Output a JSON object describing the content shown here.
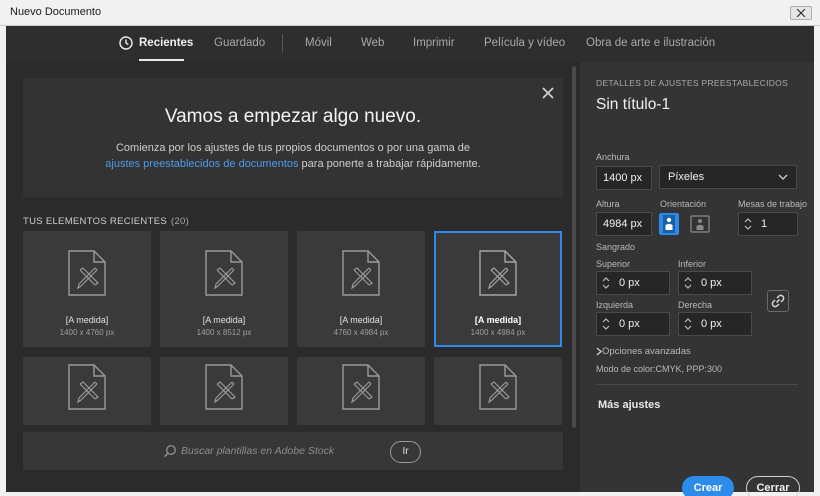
{
  "window": {
    "title": "Nuevo Documento"
  },
  "tabs": [
    {
      "label": "Recientes",
      "active": true
    },
    {
      "label": "Guardado"
    },
    {
      "label": "Móvil"
    },
    {
      "label": "Web"
    },
    {
      "label": "Imprimir"
    },
    {
      "label": "Película y vídeo"
    },
    {
      "label": "Obra de arte e ilustración"
    }
  ],
  "hero": {
    "title": "Vamos a empezar algo nuevo.",
    "desc_line1": "Comienza por los ajustes de tus propios documentos o por una gama de",
    "desc_link": "ajustes preestablecidos de documentos",
    "desc_line2_tail": " para ponerte a trabajar rápidamente."
  },
  "recent": {
    "header": "TUS ELEMENTOS RECIENTES",
    "count": "(20)",
    "items": [
      {
        "name": "[A medida]",
        "size": "1400 x 4760 px"
      },
      {
        "name": "[A medida]",
        "size": "1400 x 8512 px"
      },
      {
        "name": "[A medida]",
        "size": "4760 x 4984 px"
      },
      {
        "name": "[A medida]",
        "size": "1400 x 4984 px",
        "selected": true
      }
    ]
  },
  "search": {
    "placeholder": "Buscar plantillas en Adobe Stock",
    "go_label": "Ir"
  },
  "preset": {
    "section_title": "DETALLES DE AJUSTES PREESTABLECIDOS",
    "name": "Sin título-1",
    "width_label": "Anchura",
    "width_value": "1400 px",
    "unit": "Píxeles",
    "height_label": "Altura",
    "height_value": "4984 px",
    "orientation_label": "Orientación",
    "artboards_label": "Mesas de trabajo",
    "artboards_value": "1",
    "bleed_label": "Sangrado",
    "top_label": "Superior",
    "top_value": "0 px",
    "bottom_label": "Inferior",
    "bottom_value": "0 px",
    "left_label": "Izquierda",
    "left_value": "0 px",
    "right_label": "Derecha",
    "right_value": "0 px",
    "advanced": "Opciones avanzadas",
    "color_mode": "Modo de color:CMYK, PPP:300",
    "more": "Más ajustes"
  },
  "buttons": {
    "create": "Crear",
    "close": "Cerrar"
  },
  "colors": {
    "accent": "#2d8ceb",
    "link": "#4d9bea",
    "background": "#2e2e2e"
  }
}
